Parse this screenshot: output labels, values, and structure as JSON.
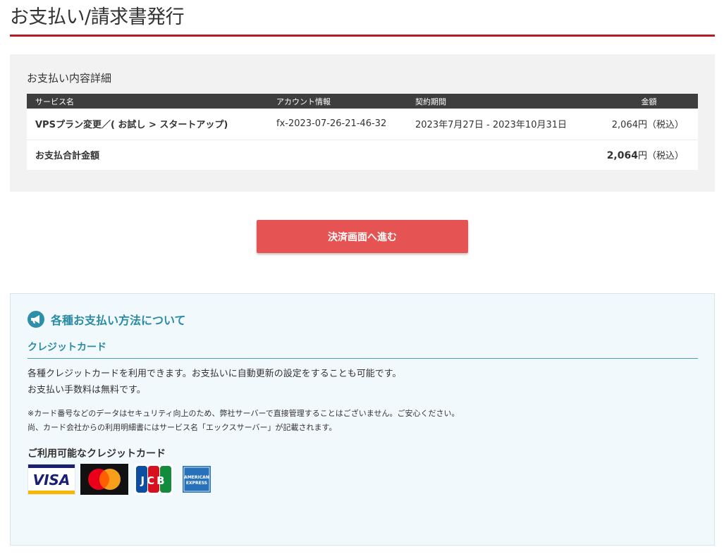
{
  "page": {
    "title": "お支払い/請求書発行"
  },
  "details": {
    "heading": "お支払い内容詳細",
    "columns": {
      "service": "サービス名",
      "account": "アカウント情報",
      "period": "契約期間",
      "amount": "金額"
    },
    "item": {
      "service": "VPSプラン変更／( お試し > スタートアップ)",
      "account": "fx-2023-07-26-21-46-32",
      "period": "2023年7月27日 - 2023年10月31日",
      "amount": "2,064円（税込）"
    },
    "total": {
      "label": "お支払合計金額",
      "amount_number": "2,064",
      "amount_suffix": "円（税込）"
    }
  },
  "actions": {
    "proceed_label": "決済画面へ進む"
  },
  "info": {
    "title": "各種お支払い方法について",
    "credit_heading": "クレジットカード",
    "desc_1": "各種クレジットカードを利用できます。お支払いに自動更新の設定をすることも可能です。",
    "desc_2": "お支払い手数料は無料です。",
    "note_1": "※カード番号などのデータはセキュリティ向上のため、弊社サーバーで直接管理することはございません。ご安心ください。",
    "note_2": "尚、カード会社からの利用明細書にはサービス名「エックスサーバー」が記載されます。",
    "available_title": "ご利用可能なクレジットカード",
    "card_brands": {
      "visa": "VISA",
      "jcb": "JCB",
      "amex_line1": "AMERICAN",
      "amex_line2": "EXPRESS"
    }
  },
  "colors": {
    "accent_red": "#b21e23",
    "button_red": "#e55353",
    "teal": "#2a8ba5"
  },
  "icons": {
    "info_icon": "megaphone-icon"
  }
}
